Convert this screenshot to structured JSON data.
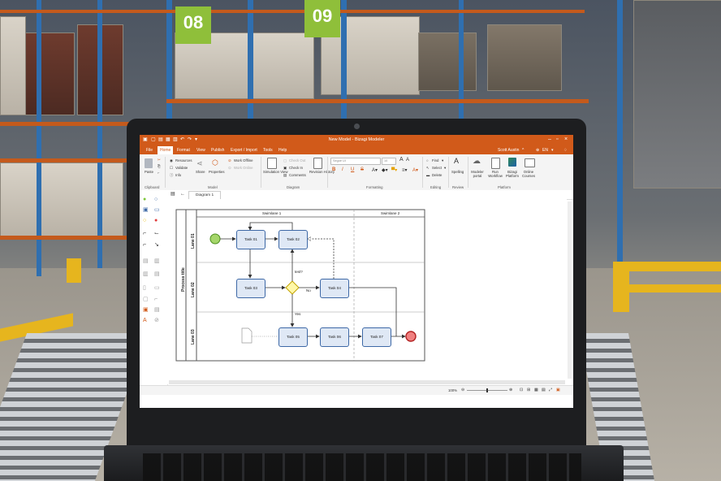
{
  "background": {
    "rack_signs": [
      "08",
      "09"
    ]
  },
  "app": {
    "window_title": "New Model - Bizagi Modeler",
    "user_name": "Scott Austin",
    "language": "EN",
    "menu": [
      "File",
      "Home",
      "Format",
      "View",
      "Publish",
      "Export / Import",
      "Tools",
      "Help"
    ],
    "active_menu": "Home",
    "accent_color": "#d15a1a"
  },
  "ribbon": {
    "clipboard": {
      "paste": "Paste",
      "group": "Clipboard"
    },
    "model": {
      "resources": "Resources",
      "validate": "Validate",
      "info": "Info",
      "share": "Share",
      "properties": "Properties",
      "work_offline": "Work Offline",
      "work_online": "Work Online",
      "group": "Model"
    },
    "diagram": {
      "simulation_view": "Simulation View",
      "check_out": "Check Out",
      "check_in": "Check In",
      "comments": "Comments",
      "revision_history": "Revision History",
      "group": "Diagram"
    },
    "formatting": {
      "font": "Segoe UI",
      "size": "10",
      "group": "Formatting"
    },
    "editing": {
      "find": "Find",
      "select": "Select",
      "delete": "Delete",
      "group": "Editing"
    },
    "review": {
      "spelling": "Spelling",
      "group": "Review"
    },
    "platform": {
      "modeler_portal": "Modeler portal",
      "run_workflow": "Run Workflow",
      "bizagi_platform": "Bizagi Platform",
      "online_courses": "Online Courses",
      "group": "Platform"
    }
  },
  "document_tab": "Diagram 1",
  "diagram": {
    "process_title": "Process title",
    "swimlanes": [
      "Swimlane 1",
      "Swimlane 2"
    ],
    "lanes": [
      "Lane 01",
      "Lane 02",
      "Lane 03"
    ],
    "tasks": [
      "Task 01",
      "Task 02",
      "Task 03",
      "Task 04",
      "Task 05",
      "Task 06",
      "Task 07"
    ],
    "gateway_label": "test?",
    "flow_labels": {
      "no": "No",
      "yes": "Yes"
    }
  },
  "status": {
    "zoom": "100%"
  }
}
